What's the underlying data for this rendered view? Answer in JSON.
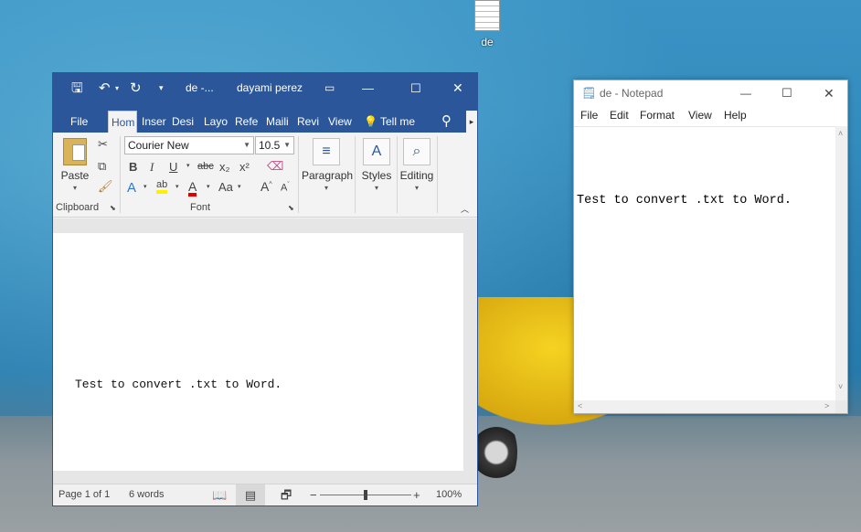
{
  "desktop": {
    "icon_label": "de"
  },
  "word": {
    "title": "de -...",
    "user": "dayami perez",
    "tabs": [
      "File",
      "Hom",
      "Inser",
      "Desi",
      "Layo",
      "Refe",
      "Maili",
      "Revi",
      "View"
    ],
    "tell_me": "Tell me",
    "clipboard": {
      "paste": "Paste",
      "group": "Clipboard"
    },
    "font": {
      "name": "Courier New",
      "size": "10.5",
      "group": "Font"
    },
    "paragraph": "Paragraph",
    "styles": "Styles",
    "editing": "Editing",
    "document_text": "Test to convert .txt to Word.",
    "status": {
      "page": "Page 1 of 1",
      "words": "6 words",
      "zoom": "100%"
    }
  },
  "notepad": {
    "title": "de - Notepad",
    "menu": [
      "File",
      "Edit",
      "Format",
      "View",
      "Help"
    ],
    "text": "Test to convert .txt to Word."
  }
}
